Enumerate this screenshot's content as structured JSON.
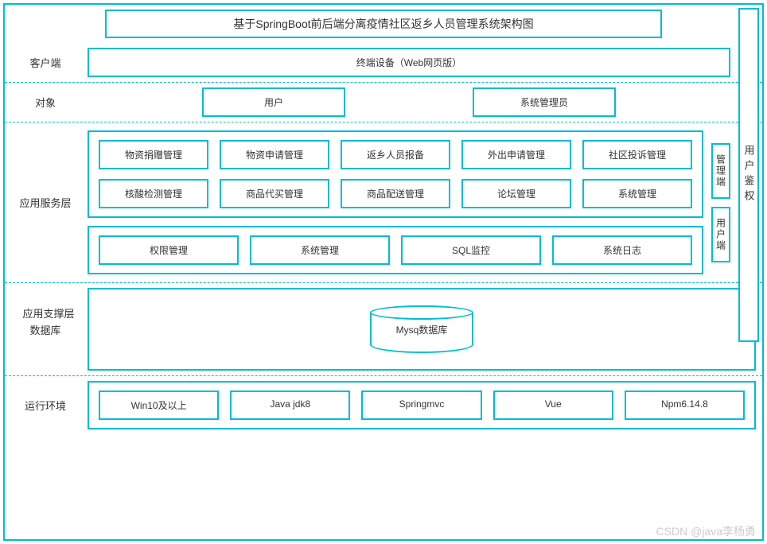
{
  "title": "基于SpringBoot前后端分离疫情社区返乡人员管理系统架构图",
  "auth_label": "用户鉴权",
  "layers": {
    "client": {
      "label": "客户端",
      "box": "终端设备（Web网页版）"
    },
    "actors": {
      "label": "对象",
      "items": [
        "用户",
        "系统管理员"
      ]
    },
    "service": {
      "label": "应用服务层",
      "row1": [
        "物资捐赠管理",
        "物资申请管理",
        "返乡人员报备",
        "外出申请管理",
        "社区投诉管理"
      ],
      "row2": [
        "核酸检测管理",
        "商品代买管理",
        "商品配送管理",
        "论坛管理",
        "系统管理"
      ],
      "side": {
        "admin": "管理端",
        "user": "用户端"
      }
    },
    "support": {
      "label": "应用支撑层",
      "items": [
        "权限管理",
        "系统管理",
        "SQL监控",
        "系统日志"
      ]
    },
    "db": {
      "label": "数据库",
      "cylinder": "Mysq数据库"
    },
    "runtime": {
      "label": "运行环境",
      "items": [
        "Win10及以上",
        "Java jdk8",
        "Springmvc",
        "Vue",
        "Npm6.14.8"
      ]
    }
  },
  "watermark": "CSDN @java李杨勇"
}
